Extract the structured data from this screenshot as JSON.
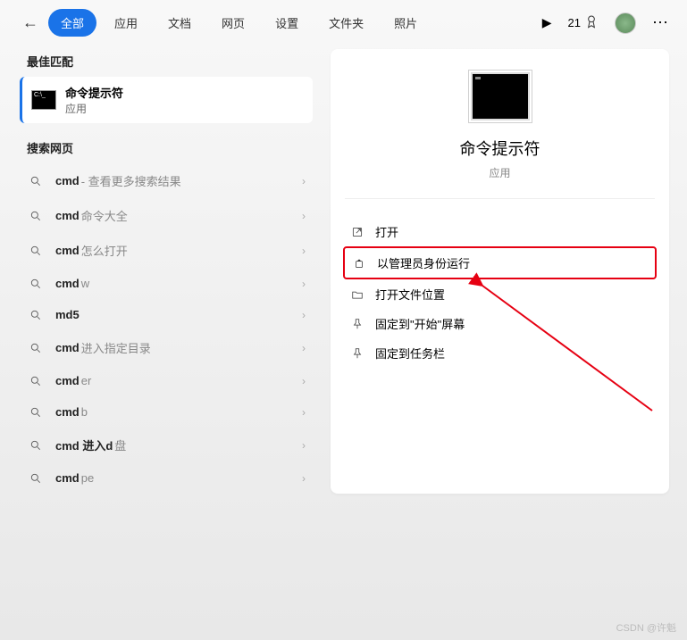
{
  "header": {
    "tabs": [
      "全部",
      "应用",
      "文档",
      "网页",
      "设置",
      "文件夹",
      "照片"
    ],
    "active_tab": 0,
    "count": "21"
  },
  "left": {
    "best_match_label": "最佳匹配",
    "best_match": {
      "title": "命令提示符",
      "subtitle": "应用"
    },
    "search_web_label": "搜索网页",
    "items": [
      {
        "bold": "cmd",
        "rest": " - 查看更多搜索结果"
      },
      {
        "bold": "cmd",
        "rest": "命令大全"
      },
      {
        "bold": "cmd",
        "rest": "怎么打开"
      },
      {
        "bold": "cmd",
        "rest": "w"
      },
      {
        "bold": "md5",
        "rest": ""
      },
      {
        "bold": "cmd",
        "rest": "进入指定目录"
      },
      {
        "bold": "cmd",
        "rest": "er"
      },
      {
        "bold": "cmd",
        "rest": "b"
      },
      {
        "bold": "cmd 进入d",
        "rest": "盘"
      },
      {
        "bold": "cmd",
        "rest": "pe"
      }
    ]
  },
  "right": {
    "title": "命令提示符",
    "subtitle": "应用",
    "actions": [
      {
        "icon": "open",
        "label": "打开",
        "hl": false
      },
      {
        "icon": "admin",
        "label": "以管理员身份运行",
        "hl": true
      },
      {
        "icon": "folder",
        "label": "打开文件位置",
        "hl": false
      },
      {
        "icon": "pin",
        "label": "固定到\"开始\"屏幕",
        "hl": false
      },
      {
        "icon": "pin",
        "label": "固定到任务栏",
        "hl": false
      }
    ]
  },
  "watermark": "CSDN @许魁"
}
